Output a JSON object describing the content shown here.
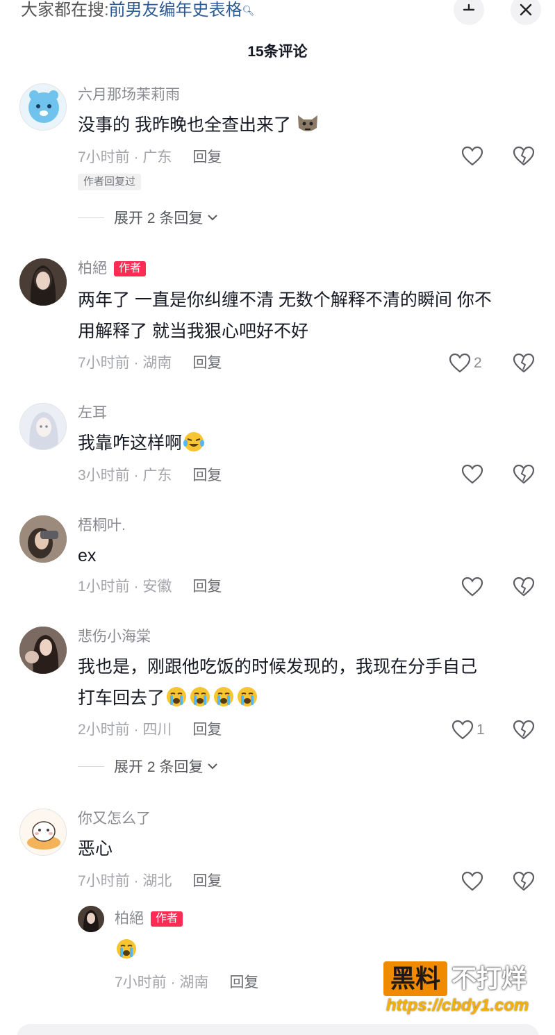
{
  "header": {
    "search_prefix": "大家都在搜:",
    "search_keyword": "前男友编年史表格",
    "collapse_icon": "collapse-icon",
    "close_icon": "close-icon"
  },
  "comments_count": "15条评论",
  "comments": [
    {
      "username": "六月那场茉莉雨",
      "text": "没事的 我昨晚也全查出来了",
      "emoji": "wolf-emoji",
      "meta": "7小时前 · 广东",
      "reply": "回复",
      "likes": "",
      "badge": "作者回复过",
      "expand": "展开 2 条回复"
    },
    {
      "username": "柏絕",
      "author_tag": "作者",
      "text_line1": "两年了 一直是你纠缠不清 无数个解释不清的瞬间 你不",
      "text_line2": "用解释了 就当我狠心吧好不好",
      "meta": "7小时前 · 湖南",
      "reply": "回复",
      "likes": "2"
    },
    {
      "username": "左耳",
      "text": "我靠咋这样啊",
      "emoji": "crying-laughing-emoji",
      "meta": "3小时前 · 广东",
      "reply": "回复",
      "likes": ""
    },
    {
      "username": "梧桐叶.",
      "text": "ex",
      "meta": "1小时前 · 安徽",
      "reply": "回复",
      "likes": ""
    },
    {
      "username": "悲伤小海棠",
      "text_line1": "我也是，刚跟他吃饭的时候发现的，我现在分手自己",
      "text_line2": "打车回去了",
      "emoji": "crying-emoji",
      "meta": "2小时前 · 四川",
      "reply": "回复",
      "likes": "1",
      "expand": "展开 2 条回复"
    },
    {
      "username": "你又怎么了",
      "text": "恶心",
      "meta": "7小时前 · 湖北",
      "reply": "回复",
      "likes": ""
    }
  ],
  "sub_reply": {
    "username": "柏絕",
    "author_tag": "作者",
    "emoji": "crying-emoji",
    "meta": "7小时前 · 湖南",
    "reply": "回复"
  },
  "watermark": {
    "box": "黑料",
    "text": "不打烊",
    "url": "https://cbdy1.com"
  },
  "colors": {
    "accent": "#fe2c55",
    "keyword": "#2b5a94",
    "watermark": "#f08a00"
  }
}
